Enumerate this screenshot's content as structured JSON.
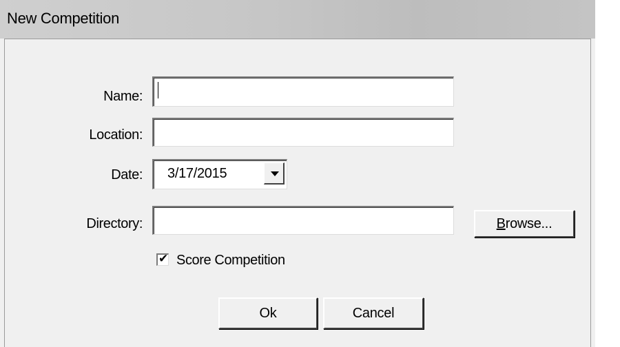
{
  "window": {
    "title": "New Competition"
  },
  "form": {
    "name_label": "Name:",
    "name_value": "",
    "location_label": "Location:",
    "location_value": "",
    "date_label": "Date:",
    "date_value": "3/17/2015",
    "directory_label": "Directory:",
    "directory_value": "",
    "browse_label_first": "B",
    "browse_label_rest": "rowse...",
    "score_checkbox_label": "Score Competition",
    "score_checked": true
  },
  "buttons": {
    "ok_label": "Ok",
    "cancel_label": "Cancel"
  },
  "icons": {
    "date_dropdown": "chevron-down-icon",
    "checkmark": "checkmark-icon"
  }
}
